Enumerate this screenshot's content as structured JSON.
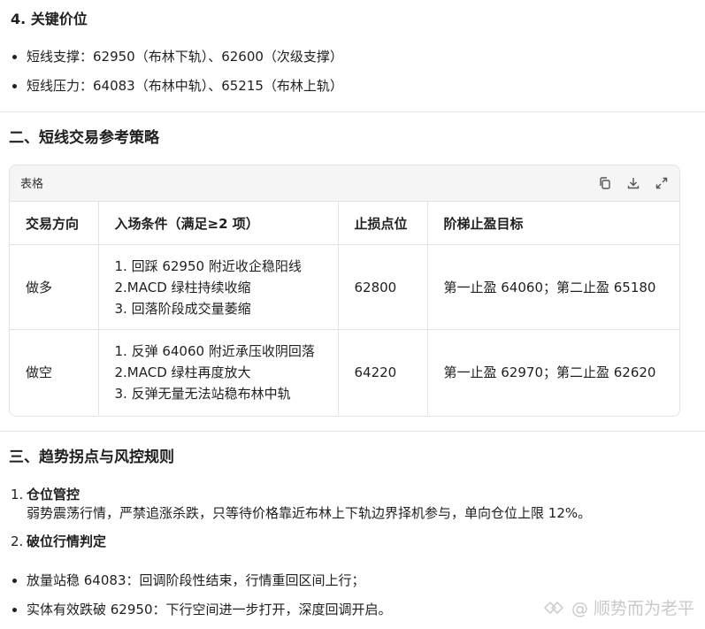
{
  "section4": {
    "heading": "4. 关键价位",
    "bullets": [
      "短线支撑：62950（布林下轨）、62600（次级支撑）",
      "短线压力：64083（布林中轨）、65215（布林上轨）"
    ]
  },
  "section2": {
    "heading": "二、短线交易参考策略",
    "table_card": {
      "label": "表格",
      "icons": [
        "copy-icon",
        "download-icon",
        "expand-icon"
      ],
      "columns": [
        "交易方向",
        "入场条件（满足≥2 项）",
        "止损点位",
        "阶梯止盈目标"
      ],
      "rows": [
        {
          "direction": "做多",
          "conditions": [
            "1. 回踩 62950 附近收企稳阳线",
            "2.MACD 绿柱持续收缩",
            "3. 回落阶段成交量萎缩"
          ],
          "stop_loss": "62800",
          "targets": "第一止盈 64060；第二止盈 65180"
        },
        {
          "direction": "做空",
          "conditions": [
            "1. 反弹 64060 附近承压收阴回落",
            "2.MACD 绿柱再度放大",
            "3. 反弹无量无法站稳布林中轨"
          ],
          "stop_loss": "64220",
          "targets": "第一止盈 62970；第二止盈 62620"
        }
      ]
    }
  },
  "section3": {
    "heading": "三、趋势拐点与风控规则",
    "items": [
      {
        "num": "1.",
        "title": "仓位管控",
        "desc": "弱势震荡行情，严禁追涨杀跌，只等待价格靠近布林上下轨边界择机参与，单向仓位上限 12%。"
      },
      {
        "num": "2.",
        "title": "破位行情判定",
        "desc": ""
      }
    ],
    "bullets": [
      "放量站稳 64083：回调阶段性结束，行情重回区间上行；",
      "实体有效跌破 62950：下行空间进一步打开，深度回调开启。"
    ]
  },
  "watermark": {
    "text": "@ 顺势而为老平",
    "icon": "watermark-logo-icon"
  }
}
